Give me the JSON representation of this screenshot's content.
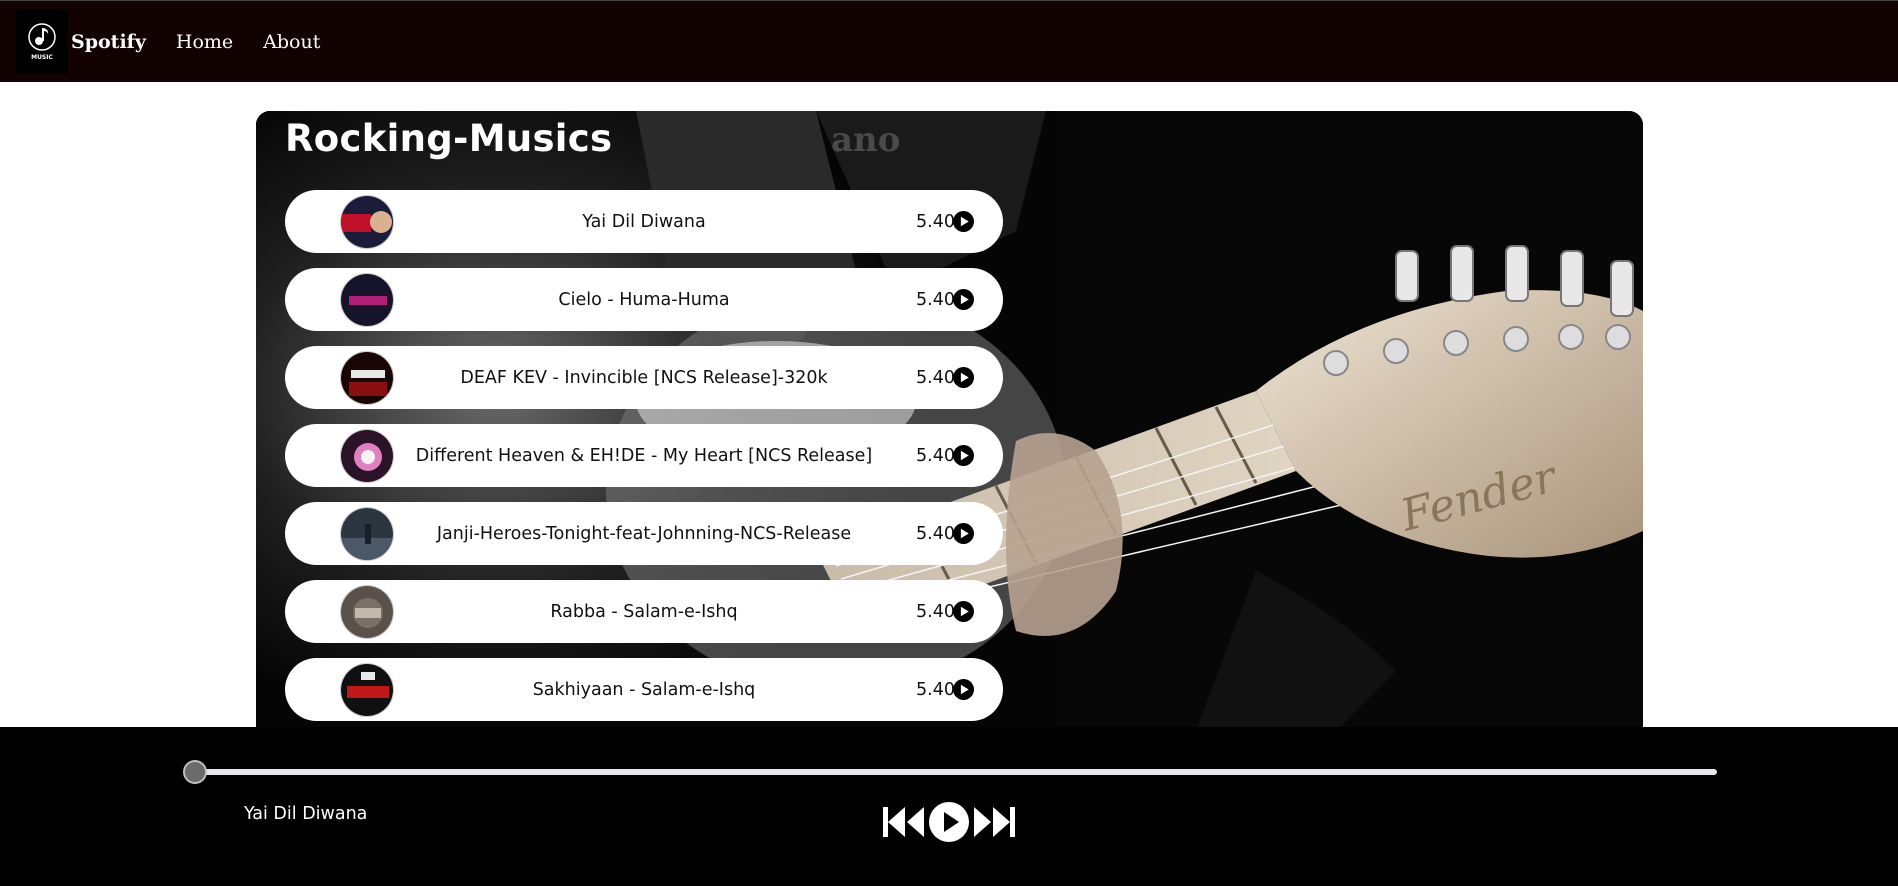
{
  "navbar": {
    "logo_text": "MUSIC",
    "brand": "Spotify",
    "links": [
      "Home",
      "About"
    ]
  },
  "main": {
    "title": "Rocking-Musics",
    "songs": [
      {
        "name": "Yai Dil Diwana",
        "duration": "5.40",
        "cover_color": "#7a1020"
      },
      {
        "name": "Cielo - Huma-Huma",
        "duration": "5.40",
        "cover_color": "#1a1830"
      },
      {
        "name": "DEAF KEV - Invincible [NCS Release]-320k",
        "duration": "5.40",
        "cover_color": "#2a0808"
      },
      {
        "name": "Different Heaven & EH!DE - My Heart [NCS Release]",
        "duration": "5.40",
        "cover_color": "#3a1838"
      },
      {
        "name": "Janji-Heroes-Tonight-feat-Johnning-NCS-Release",
        "duration": "5.40",
        "cover_color": "#3a4450"
      },
      {
        "name": "Rabba - Salam-e-Ishq",
        "duration": "5.40",
        "cover_color": "#4a4440"
      },
      {
        "name": "Sakhiyaan - Salam-e-Ishq",
        "duration": "5.40",
        "cover_color": "#181010"
      }
    ]
  },
  "player": {
    "now_playing": "Yai Dil Diwana",
    "progress": 0.0
  },
  "colors": {
    "navbar_bg": "#120202",
    "player_bg": "#000000",
    "song_item_bg": "#ffffff"
  }
}
